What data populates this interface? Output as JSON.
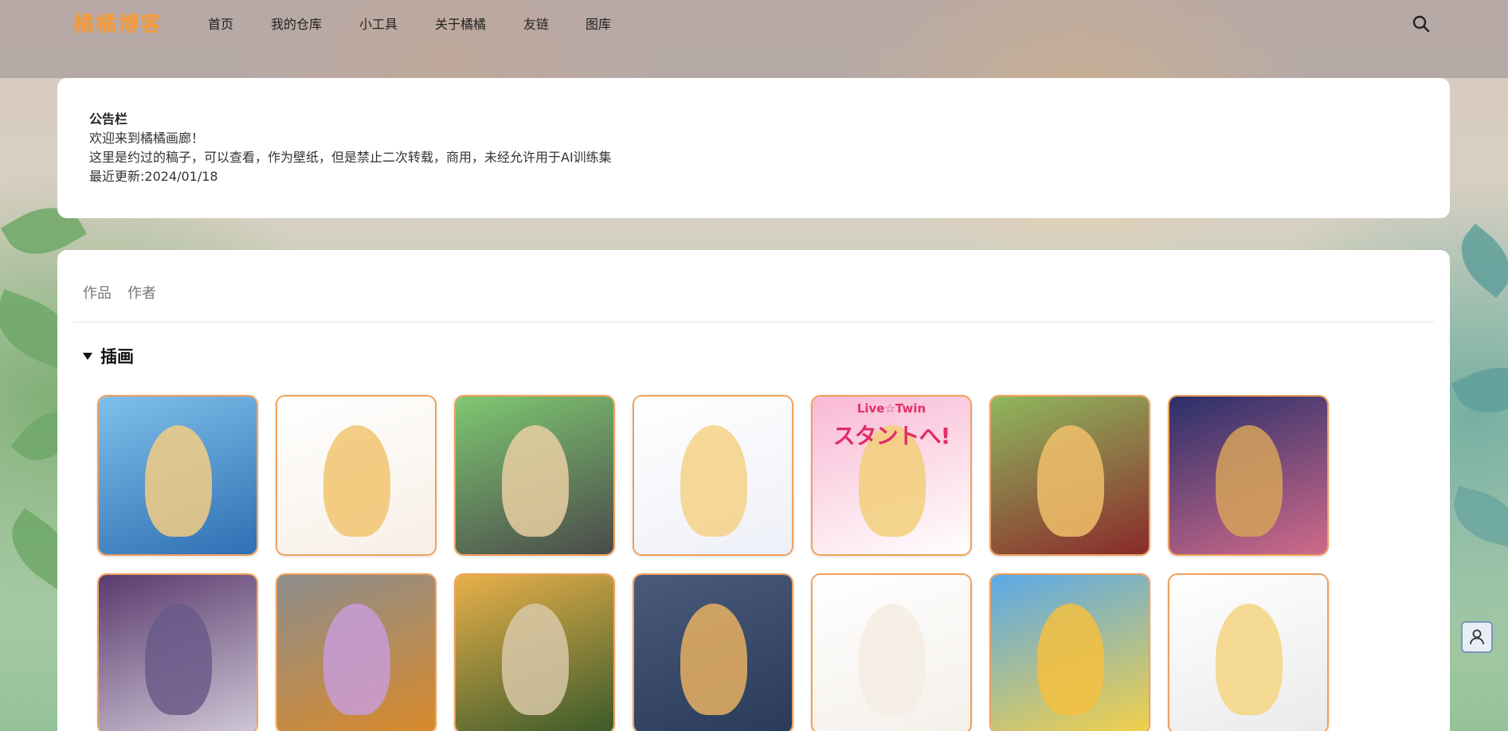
{
  "colors": {
    "brand": "#f39a3c",
    "thumb_border": "#f1a05a",
    "card_bg": "#ffffff"
  },
  "header": {
    "logo_text": "橘橘博客",
    "nav": [
      "首页",
      "我的仓库",
      "小工具",
      "关于橘橘",
      "友链",
      "图库"
    ],
    "search_icon": "search-icon"
  },
  "notice": {
    "title": "公告栏",
    "lines": [
      "欢迎来到橘橘画廊！",
      "这里是约过的稿子，可以查看，作为壁纸，但是禁止二次转载，商用，未经允许用于AI训练集",
      "最近更新:2024/01/18"
    ]
  },
  "tabs": [
    "作品",
    "作者"
  ],
  "section": {
    "title": "插画",
    "expanded": true
  },
  "thumbnails": [
    {
      "palette": [
        "#7fc0ea",
        "#2f6fb4"
      ],
      "fig": "#f3cd83",
      "caption": ""
    },
    {
      "palette": [
        "#ffffff",
        "#f7efe6"
      ],
      "fig": "#f1c46f",
      "caption": ""
    },
    {
      "palette": [
        "#7fc872",
        "#4a4a4a"
      ],
      "fig": "#e9cfa2",
      "caption": ""
    },
    {
      "palette": [
        "#ffffff",
        "#eef0f8"
      ],
      "fig": "#f4d186",
      "caption": ""
    },
    {
      "palette": [
        "#f9b9d3",
        "#ffffff"
      ],
      "fig": "#f2cf7a",
      "caption": "Live☆Twin",
      "banner": "スタントへ!"
    },
    {
      "palette": [
        "#8fb85e",
        "#8a2a2a"
      ],
      "fig": "#f0c06a",
      "caption": ""
    },
    {
      "palette": [
        "#2a2f6a",
        "#d06a8a"
      ],
      "fig": "#d6a25a",
      "caption": ""
    },
    {
      "palette": [
        "#5a3a6e",
        "#cfc7d6"
      ],
      "fig": "#6a5a8a",
      "caption": ""
    },
    {
      "palette": [
        "#8d8d8d",
        "#d98a2a"
      ],
      "fig": "#c89bd8",
      "caption": ""
    },
    {
      "palette": [
        "#e8b04a",
        "#3a5a2a"
      ],
      "fig": "#d8c8a8",
      "caption": ""
    },
    {
      "palette": [
        "#4a5a7a",
        "#2a3a5a"
      ],
      "fig": "#e8b060",
      "caption": ""
    },
    {
      "palette": [
        "#ffffff",
        "#f4f0ea"
      ],
      "fig": "#f4ece2",
      "caption": ""
    },
    {
      "palette": [
        "#5aa9e8",
        "#f2d04a"
      ],
      "fig": "#f5c040",
      "caption": ""
    },
    {
      "palette": [
        "#ffffff",
        "#eaeaea"
      ],
      "fig": "#f4d582",
      "caption": ""
    }
  ],
  "floating": {
    "user_icon": "user-icon"
  }
}
